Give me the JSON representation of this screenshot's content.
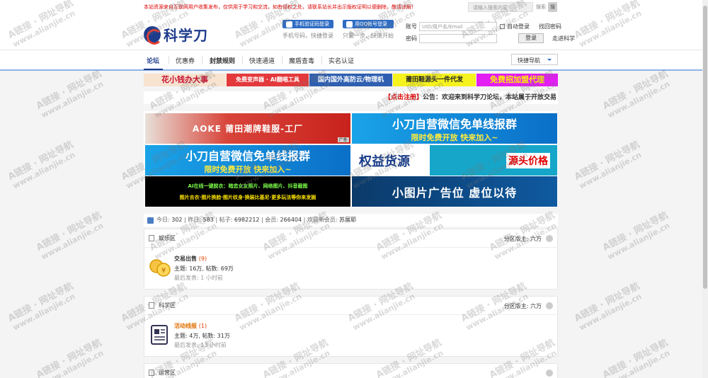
{
  "topbar": {
    "notice": "本站资源来自互联网用户收集发布，仅供用于学习和交流，如有侵权之处，请联系站长并出示版权证明以便删除，敬请谅解!",
    "search_placeholder": "请输入搜索内容",
    "search_label": "搜索",
    "search_button": "搜"
  },
  "header": {
    "logo_text": "科学刀",
    "phone_login_label": "手机验证码登录",
    "phone_login_sub": "手机号码，快捷登录",
    "qq_login_label": "用QQ帐号登录",
    "qq_login_sub": "只需一步，快速开始",
    "account_label": "账号",
    "account_placeholder": "UID/用户名/Email",
    "password_label": "密码",
    "auto_login": "自动登录",
    "forgot_password": "找回密码",
    "login_button": "登录",
    "enter_science": "走进科学"
  },
  "nav": {
    "items": [
      "论坛",
      "优惠券",
      "封禁规则",
      "快速通道",
      "魔盾查毒",
      "实名认证"
    ],
    "quick_nav": "快捷导航"
  },
  "strip_ads": [
    {
      "text": "花小钱办大事",
      "bg": "#f7e3d0",
      "color": "#c8102e"
    },
    {
      "text": "免费变声器 · AI翻唱工具",
      "bg": "#e4393c",
      "color": "#ffffff"
    },
    {
      "text": "国内国外高防云/物理机",
      "bg": "#2f5fb0",
      "color": "#ffffff"
    },
    {
      "text": "莆田鞋源头一件代发",
      "bg": "#f5f21e",
      "color": "#222222"
    },
    {
      "text": "免费招加盟代理",
      "bg": "#e21ef2",
      "color": "#ffef00"
    }
  ],
  "announcement": {
    "register_link": "【点击注册】",
    "text": "公告：欢迎来到科学刀论坛，本站属于开放交易"
  },
  "big_ads": [
    {
      "main": "AOKE 莆田潮牌鞋服-工厂",
      "sub": ""
    },
    {
      "main": "小刀自营微信免单线报群",
      "sub": "限时免费开放 快来加入~"
    },
    {
      "main": "小刀自营微信免单线报群",
      "sub": "限时免费开放 快来加入~"
    },
    {
      "main": "权益货源",
      "sub": "源头价格"
    },
    {
      "main": "AI在线一键脱衣：暗恋女友照片、网络图片、抖音截图",
      "sub": "图片去衣·图片换脸·图片纹身·换装比基尼·更多玩法等你来发掘"
    },
    {
      "main": "小图片广告位 虚位以待",
      "sub": ""
    }
  ],
  "stats": {
    "today_label": "今日:",
    "today": "302",
    "yesterday_label": "昨日:",
    "yesterday": "583",
    "posts_label": "帖子:",
    "posts": "6982212",
    "members_label": "会员:",
    "members": "266404",
    "welcome_label": "欢迎新会员:",
    "new_member": "苏展耶"
  },
  "sections": [
    {
      "title": "娱乐区",
      "moderator": "分区版主: 六万",
      "forum": {
        "name": "交易出售",
        "count": "(9)",
        "meta": "主题: 16万, 帖数: 69万",
        "last": "最后发表: 1 小时前"
      }
    },
    {
      "title": "科学区",
      "moderator": "分区版主: 六万",
      "forum": {
        "name": "活动线报",
        "count": "(1)",
        "meta": "主题: 4万, 帖数: 31万",
        "last": "最后发表: 13 小时前"
      }
    },
    {
      "title": "运营区",
      "moderator": "",
      "forum": null
    }
  ],
  "watermark": {
    "line1": "A链接 · 网址导航",
    "line2": "www.alianjie.cn"
  },
  "colors": {
    "brand": "#1e3c8c",
    "accent_red": "#e63b2e",
    "link_blue": "#2f6dc4"
  }
}
